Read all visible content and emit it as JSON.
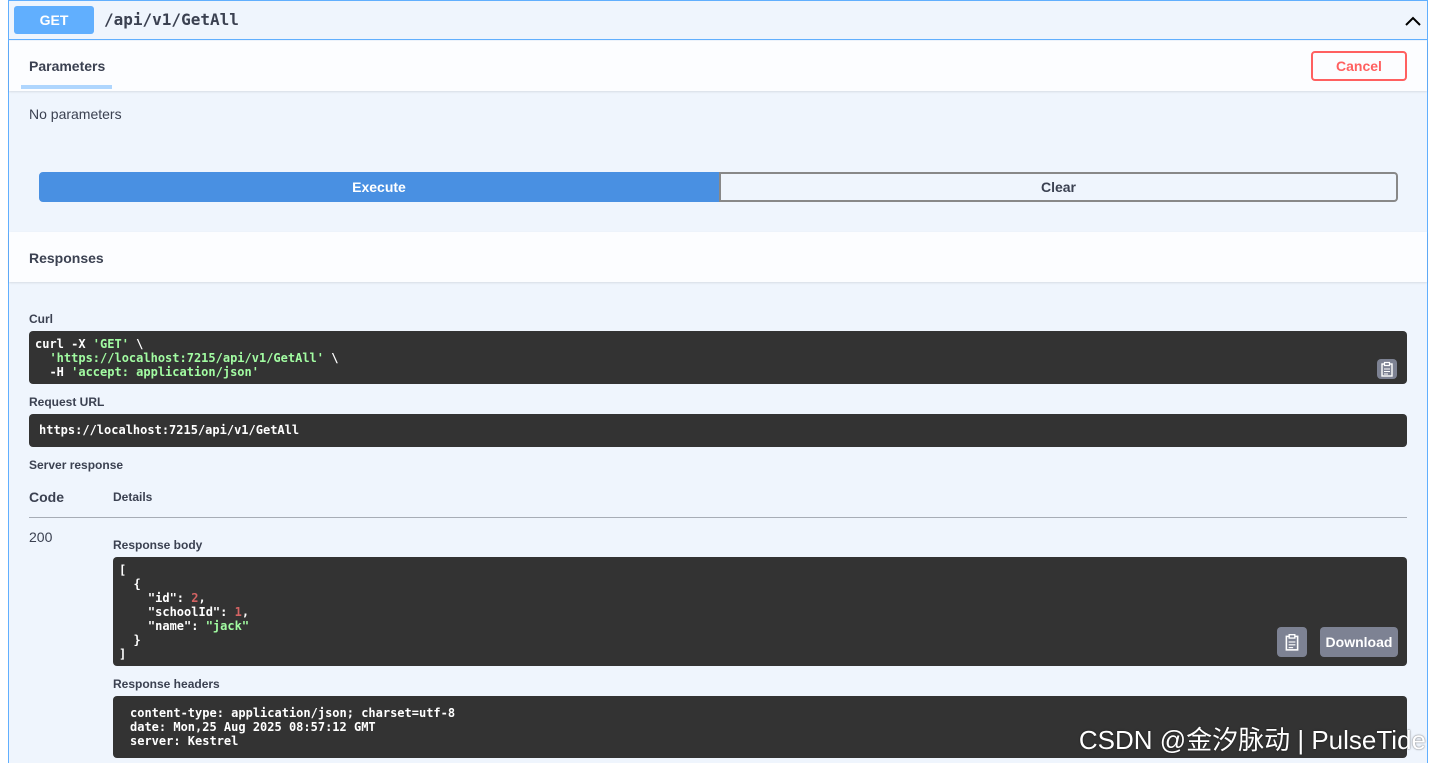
{
  "operation": {
    "method": "GET",
    "path": "/api/v1/GetAll"
  },
  "parameters": {
    "tab_label": "Parameters",
    "cancel_label": "Cancel",
    "empty_text": "No parameters"
  },
  "actions": {
    "execute_label": "Execute",
    "clear_label": "Clear"
  },
  "responses": {
    "header": "Responses",
    "curl_label": "Curl",
    "curl_lines": [
      [
        "curl -X ",
        "'GET'",
        " \\"
      ],
      [
        "  ",
        "'https://localhost:7215/api/v1/GetAll'",
        " \\"
      ],
      [
        "  -H ",
        "'accept: application/json'",
        ""
      ]
    ],
    "request_url_label": "Request URL",
    "request_url": "https://localhost:7215/api/v1/GetAll",
    "server_response_label": "Server response",
    "code_header": "Code",
    "details_header": "Details",
    "status_code": "200",
    "body_label": "Response body",
    "body": [
      {
        "id": 2,
        "schoolId": 1,
        "name": "jack"
      }
    ],
    "download_label": "Download",
    "headers_label": "Response headers",
    "headers_lines": [
      "content-type: application/json; charset=utf-8",
      "date: Mon,25 Aug 2025 08:57:12 GMT",
      "server: Kestrel"
    ]
  },
  "watermark": "CSDN @金汐脉动 | PulseTide",
  "colors": {
    "get_method": "#61affe",
    "execute": "#4990e2",
    "cancel": "#ff6060",
    "code_bg": "#333333",
    "string": "#a2fca2",
    "number": "#d36363"
  }
}
